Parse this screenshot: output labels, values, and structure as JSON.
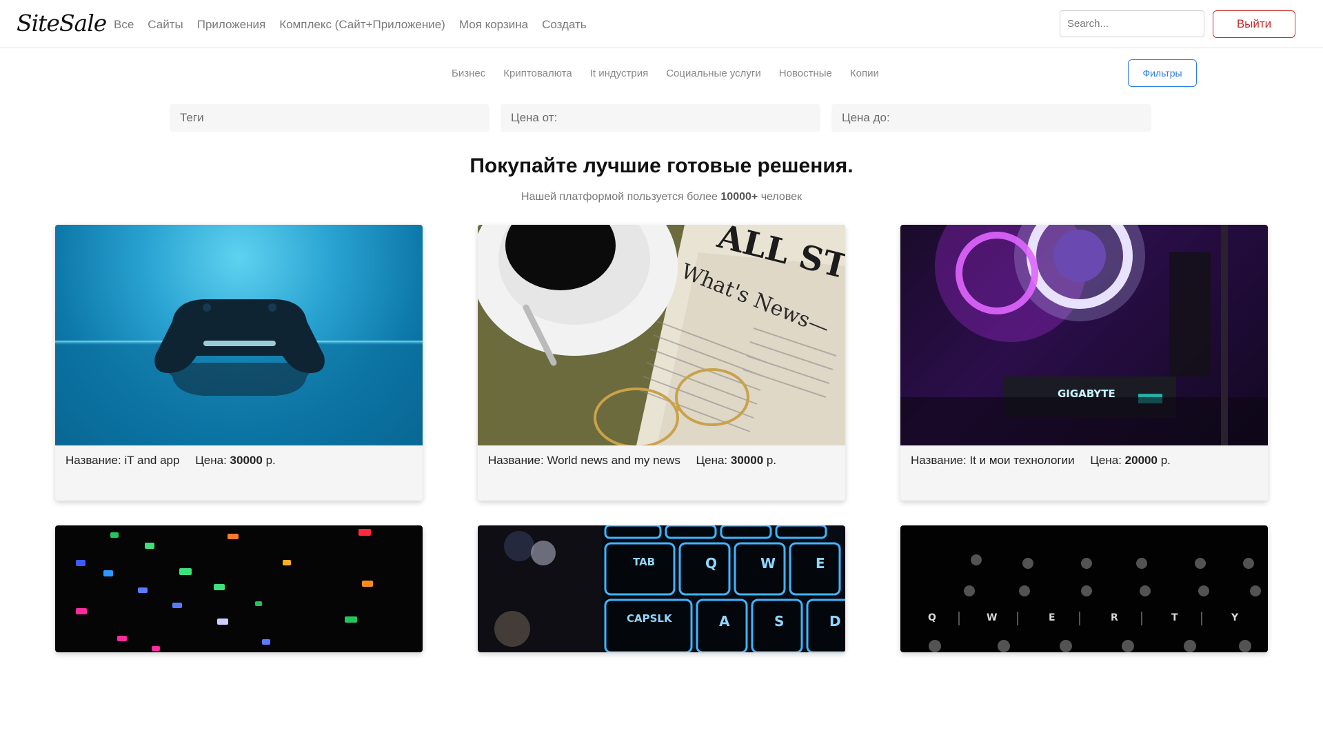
{
  "brand": {
    "logo": "SiteSale"
  },
  "nav": {
    "links": [
      "Все",
      "Сайты",
      "Приложения",
      "Комплекс (Сайт+Приложение)",
      "Моя корзина",
      "Создать"
    ],
    "search_placeholder": "Search...",
    "logout_label": "Выйти"
  },
  "categories": {
    "items": [
      "Бизнес",
      "Криптовалюта",
      "It индустрия",
      "Социальные услуги",
      "Новостные",
      "Копии"
    ],
    "filters_label": "Фильтры"
  },
  "filters": {
    "tags_placeholder": "Теги",
    "price_from_placeholder": "Цена от:",
    "price_to_placeholder": "Цена до:"
  },
  "hero": {
    "title": "Покупайте лучшие готовые решения.",
    "sub_before": "Нашей платформой пользуется более",
    "sub_count": "10000+",
    "sub_after": "человек"
  },
  "card_labels": {
    "name": "Название:",
    "price": "Цена:",
    "currency": "р."
  },
  "products": [
    {
      "name": "iT and app",
      "price": "30000",
      "image": "gamepad-photo"
    },
    {
      "name": "World news and my news",
      "price": "30000",
      "image": "newspaper-coffee-photo"
    },
    {
      "name": "It и мои технологии",
      "price": "20000",
      "image": "gaming-pc-photo"
    },
    {
      "image": "rgb-keyboard-photo"
    },
    {
      "image": "blue-backlit-keyboard-photo",
      "keys": [
        "TAB",
        "Q",
        "W",
        "E",
        "CAPSLK",
        "A",
        "S",
        "D"
      ]
    },
    {
      "image": "dark-keyboard-photo",
      "keys": [
        "Q",
        "W",
        "E",
        "R",
        "T",
        "Y"
      ]
    }
  ],
  "image_text": {
    "gpu_brand": "GIGABYTE",
    "newspaper_title": "ALL STREET",
    "newspaper_headline": "What's News—"
  }
}
